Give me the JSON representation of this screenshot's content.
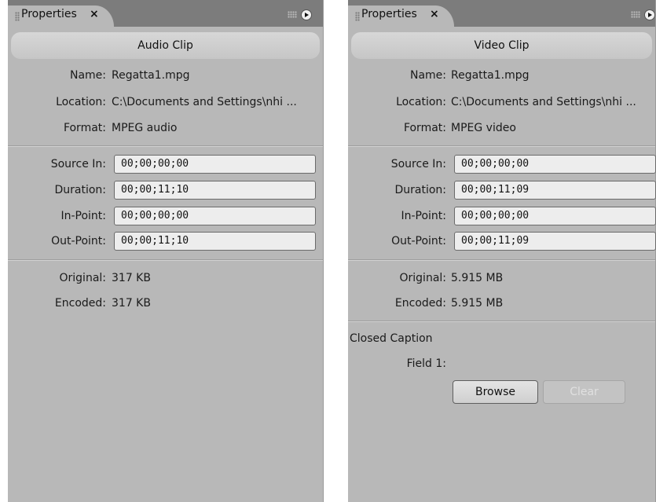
{
  "panels": [
    {
      "tab_title": "Properties",
      "tab_close": "×",
      "header": "Audio Clip",
      "info": [
        {
          "label": "Name:",
          "value": "Regatta1.mpg"
        },
        {
          "label": "Location:",
          "value": "C:\\Documents and Settings\\nhi ..."
        },
        {
          "label": "Format:",
          "value": "MPEG audio"
        }
      ],
      "timecodes": [
        {
          "label": "Source In:",
          "value": "00;00;00;00"
        },
        {
          "label": "Duration:",
          "value": "00;00;11;10"
        },
        {
          "label": "In-Point:",
          "value": "00;00;00;00"
        },
        {
          "label": "Out-Point:",
          "value": "00;00;11;10"
        }
      ],
      "sizes": [
        {
          "label": "Original:",
          "value": "317 KB"
        },
        {
          "label": "Encoded:",
          "value": "317 KB"
        }
      ]
    },
    {
      "tab_title": "Properties",
      "tab_close": "×",
      "header": "Video Clip",
      "info": [
        {
          "label": "Name:",
          "value": "Regatta1.mpg"
        },
        {
          "label": "Location:",
          "value": "C:\\Documents and Settings\\nhi ..."
        },
        {
          "label": "Format:",
          "value": "MPEG video"
        }
      ],
      "timecodes": [
        {
          "label": "Source In:",
          "value": "00;00;00;00"
        },
        {
          "label": "Duration:",
          "value": "00;00;11;09"
        },
        {
          "label": "In-Point:",
          "value": "00;00;00;00"
        },
        {
          "label": "Out-Point:",
          "value": "00;00;11;09"
        }
      ],
      "sizes": [
        {
          "label": "Original:",
          "value": "5.915 MB"
        },
        {
          "label": "Encoded:",
          "value": "5.915 MB"
        }
      ],
      "closed_caption": {
        "title": "Closed Caption",
        "field_label": "Field 1:",
        "browse_label": "Browse",
        "clear_label": "Clear"
      }
    }
  ]
}
